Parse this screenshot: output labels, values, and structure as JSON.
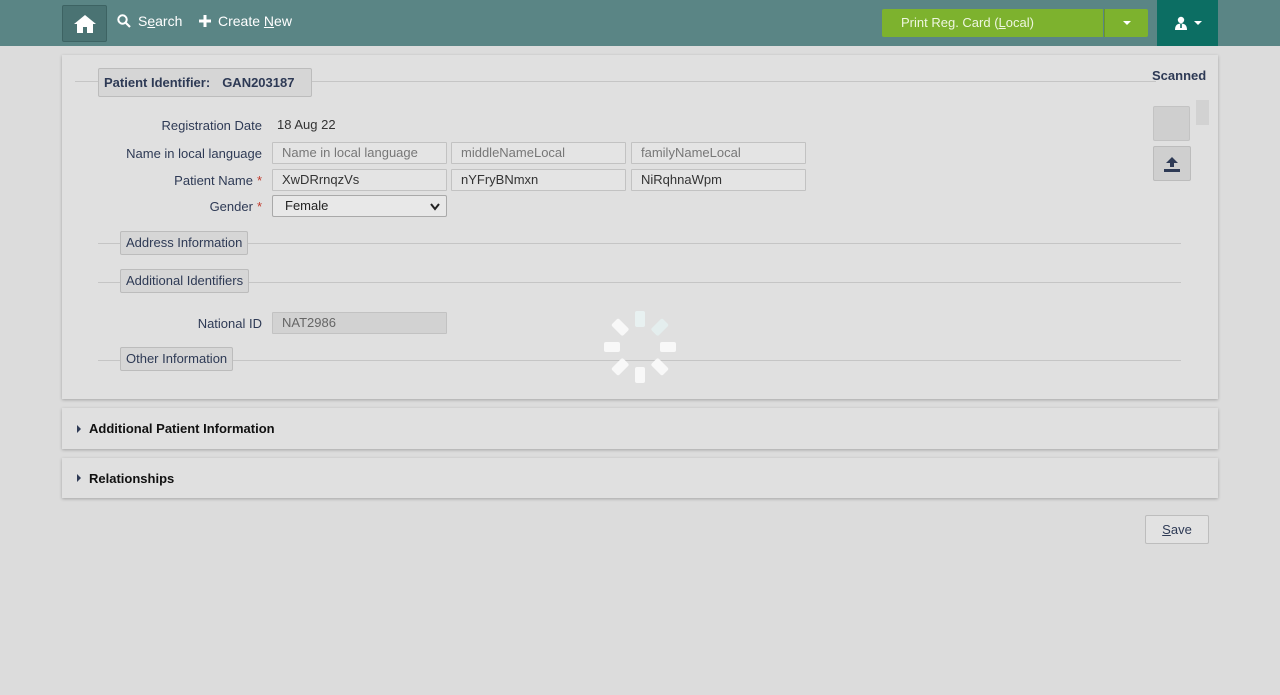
{
  "header": {
    "search_label_pre": "S",
    "search_label_key": "e",
    "search_label_post": "arch",
    "create_label_pre": "Create ",
    "create_label_key": "N",
    "create_label_post": "ew",
    "print_label_pre": "Print Reg. Card (",
    "print_label_key": "L",
    "print_label_post": "ocal)",
    "colors": {
      "bar": "#5a8585",
      "print": "#7db22e",
      "user": "#0c6e63"
    }
  },
  "patient": {
    "identifier_label": "Patient Identifier:",
    "identifier_value": "GAN203187",
    "scanned_label": "Scanned",
    "registration_date_label": "Registration Date",
    "registration_date_value": "18 Aug 22",
    "local_name_label": "Name in local language",
    "local_given_placeholder": "Name in local language",
    "local_middle_placeholder": "middleNameLocal",
    "local_family_placeholder": "familyNameLocal",
    "name_label": "Patient Name",
    "given_name": "XwDRrnqzVs",
    "middle_name": "nYFryBNmxn",
    "family_name": "NiRqhnaWpm",
    "gender_label": "Gender",
    "gender_value": "Female",
    "required_mark": "*"
  },
  "sections": {
    "address": "Address Information",
    "identifiers": "Additional Identifiers",
    "national_id_label": "National ID",
    "national_id_value": "NAT2986",
    "other": "Other Information"
  },
  "accordions": {
    "additional_info": "Additional Patient Information",
    "relationships": "Relationships"
  },
  "footer": {
    "save_key": "S",
    "save_rest": "ave"
  }
}
